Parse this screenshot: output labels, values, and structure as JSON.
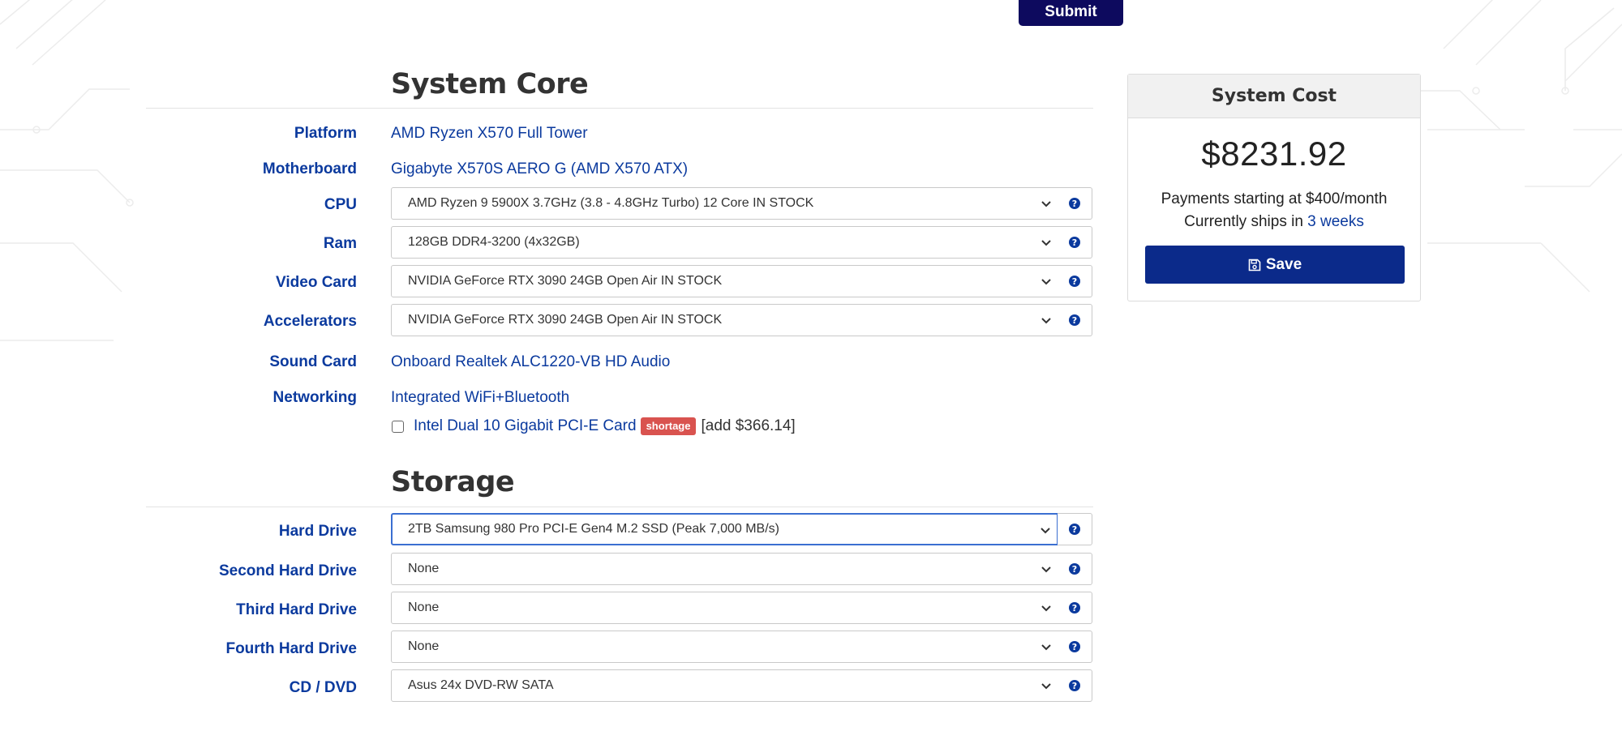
{
  "header": {
    "submit_label": "Submit"
  },
  "sections": {
    "core_title": "System Core",
    "storage_title": "Storage"
  },
  "core": {
    "platform": {
      "label": "Platform",
      "value": "AMD Ryzen X570 Full Tower"
    },
    "motherboard": {
      "label": "Motherboard",
      "value": "Gigabyte X570S AERO G (AMD X570 ATX)"
    },
    "cpu": {
      "label": "CPU",
      "value": "AMD Ryzen 9 5900X 3.7GHz (3.8 - 4.8GHz Turbo) 12 Core IN STOCK"
    },
    "ram": {
      "label": "Ram",
      "value": "128GB DDR4-3200 (4x32GB)"
    },
    "video_card": {
      "label": "Video Card",
      "value": "NVIDIA GeForce RTX 3090 24GB Open Air IN STOCK"
    },
    "accelerators": {
      "label": "Accelerators",
      "value": "NVIDIA GeForce RTX 3090 24GB Open Air IN STOCK"
    },
    "sound_card": {
      "label": "Sound Card",
      "value": "Onboard Realtek ALC1220-VB HD Audio"
    },
    "networking": {
      "label": "Networking",
      "value": "Integrated WiFi+Bluetooth",
      "addon": {
        "name": "Intel Dual 10 Gigabit PCI-E Card",
        "badge": "shortage",
        "price": "[add $366.14]",
        "checked": false
      }
    }
  },
  "storage": {
    "hard_drive": {
      "label": "Hard Drive",
      "value": "2TB Samsung 980 Pro PCI-E Gen4 M.2 SSD (Peak 7,000 MB/s)"
    },
    "second_hard_drive": {
      "label": "Second Hard Drive",
      "value": "None"
    },
    "third_hard_drive": {
      "label": "Third Hard Drive",
      "value": "None"
    },
    "fourth_hard_drive": {
      "label": "Fourth Hard Drive",
      "value": "None"
    },
    "cd_dvd": {
      "label": "CD / DVD",
      "value": "Asus 24x DVD-RW SATA"
    }
  },
  "cost_panel": {
    "title": "System Cost",
    "total": "$8231.92",
    "payments": "Payments starting at $400/month",
    "ships_prefix": "Currently ships in ",
    "ships_time": "3 weeks",
    "save_label": "Save"
  },
  "help_glyph": "?",
  "icons": {
    "help": "question-circle-icon",
    "save": "floppy-disk-icon",
    "dropdown": "chevron-down-icon"
  },
  "colors": {
    "primary_blue": "#0b3a9e",
    "submit_navy": "#0d0a5e",
    "save_navy": "#0b2a8a",
    "shortage_red": "#d9534f"
  }
}
